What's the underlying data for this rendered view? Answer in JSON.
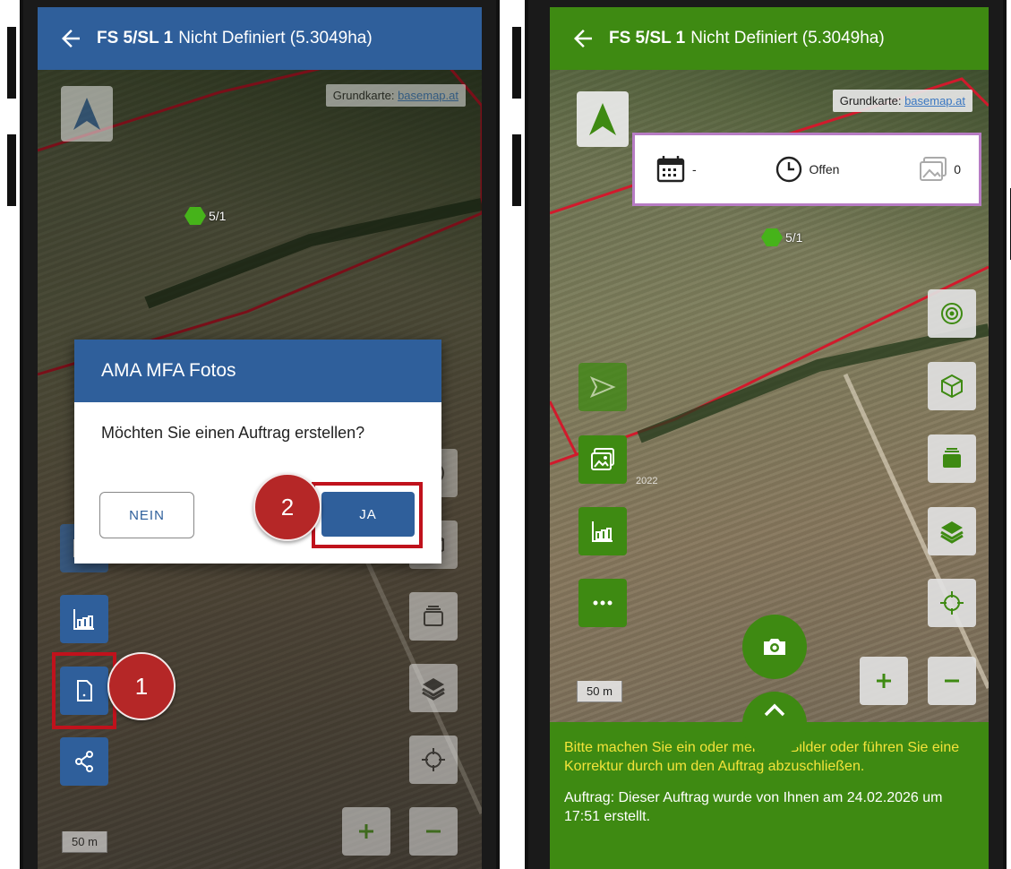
{
  "left_screen": {
    "header": {
      "field_id": "FS 5/SL 1",
      "title": "Nicht Definiert (5.3049ha)"
    },
    "basemap": {
      "label": "Grundkarte:",
      "link": "basemap.at"
    },
    "parcel_label": "5/1",
    "dialog": {
      "title": "AMA MFA Fotos",
      "message": "Möchten Sie einen Auftrag erstellen?",
      "no_label": "NEIN",
      "yes_label": "JA"
    },
    "markers": {
      "one": "1",
      "two": "2"
    },
    "scale": "50 m"
  },
  "right_screen": {
    "header": {
      "field_id": "FS 5/SL 1",
      "title": "Nicht Definiert (5.3049ha)"
    },
    "basemap": {
      "label": "Grundkarte:",
      "link": "basemap.at"
    },
    "info_card": {
      "date": "-",
      "status": "Offen",
      "photo_count": "0"
    },
    "parcel_label": "5/1",
    "year_label": "2022",
    "scale": "50 m",
    "bottom": {
      "hint": "Bitte machen Sie ein oder mehrere Bilder oder führen Sie eine Korrektur durch um den Auftrag abzuschließen.",
      "auftrag": "Auftrag: Dieser Auftrag wurde von Ihnen am 24.02.2026 um 17:51 erstellt."
    }
  },
  "colors": {
    "blue": "#2f5f9b",
    "green": "#3e8a12",
    "highlight": "#c0121c",
    "marker": "#b52727",
    "hint_yellow": "#f3e33a"
  }
}
